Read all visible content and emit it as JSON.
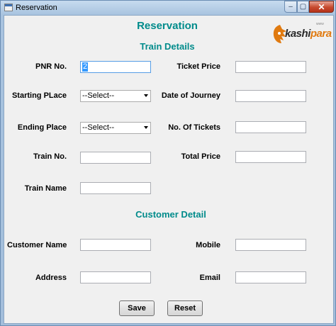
{
  "window": {
    "title": "Reservation",
    "min_label": "‒",
    "max_label": "▢",
    "close_label": "✕"
  },
  "form": {
    "heading": "Reservation",
    "train_section": "Train Details",
    "customer_section": "Customer Detail"
  },
  "logo": {
    "prefix": "kashi",
    "suffix": "para",
    "small": "www"
  },
  "fields": {
    "pnr": {
      "label": "PNR No.",
      "value": "2"
    },
    "starting_place": {
      "label": "Starting PLace",
      "value": "--Select--"
    },
    "ending_place": {
      "label": "Ending Place",
      "value": "--Select--"
    },
    "train_no": {
      "label": "Train No.",
      "value": ""
    },
    "train_name": {
      "label": "Train Name",
      "value": ""
    },
    "ticket_price": {
      "label": "Ticket Price",
      "value": ""
    },
    "date_of_journey": {
      "label": "Date of Journey",
      "value": ""
    },
    "no_of_tickets": {
      "label": "No. Of Tickets",
      "value": ""
    },
    "total_price": {
      "label": "Total Price",
      "value": ""
    },
    "customer_name": {
      "label": "Customer Name",
      "value": ""
    },
    "address": {
      "label": "Address",
      "value": ""
    },
    "mobile": {
      "label": "Mobile",
      "value": ""
    },
    "email": {
      "label": "Email",
      "value": ""
    }
  },
  "buttons": {
    "save": "Save",
    "reset": "Reset"
  },
  "colors": {
    "heading": "#008b8b",
    "logo_accent": "#e07a10",
    "selection": "#3399ff"
  }
}
